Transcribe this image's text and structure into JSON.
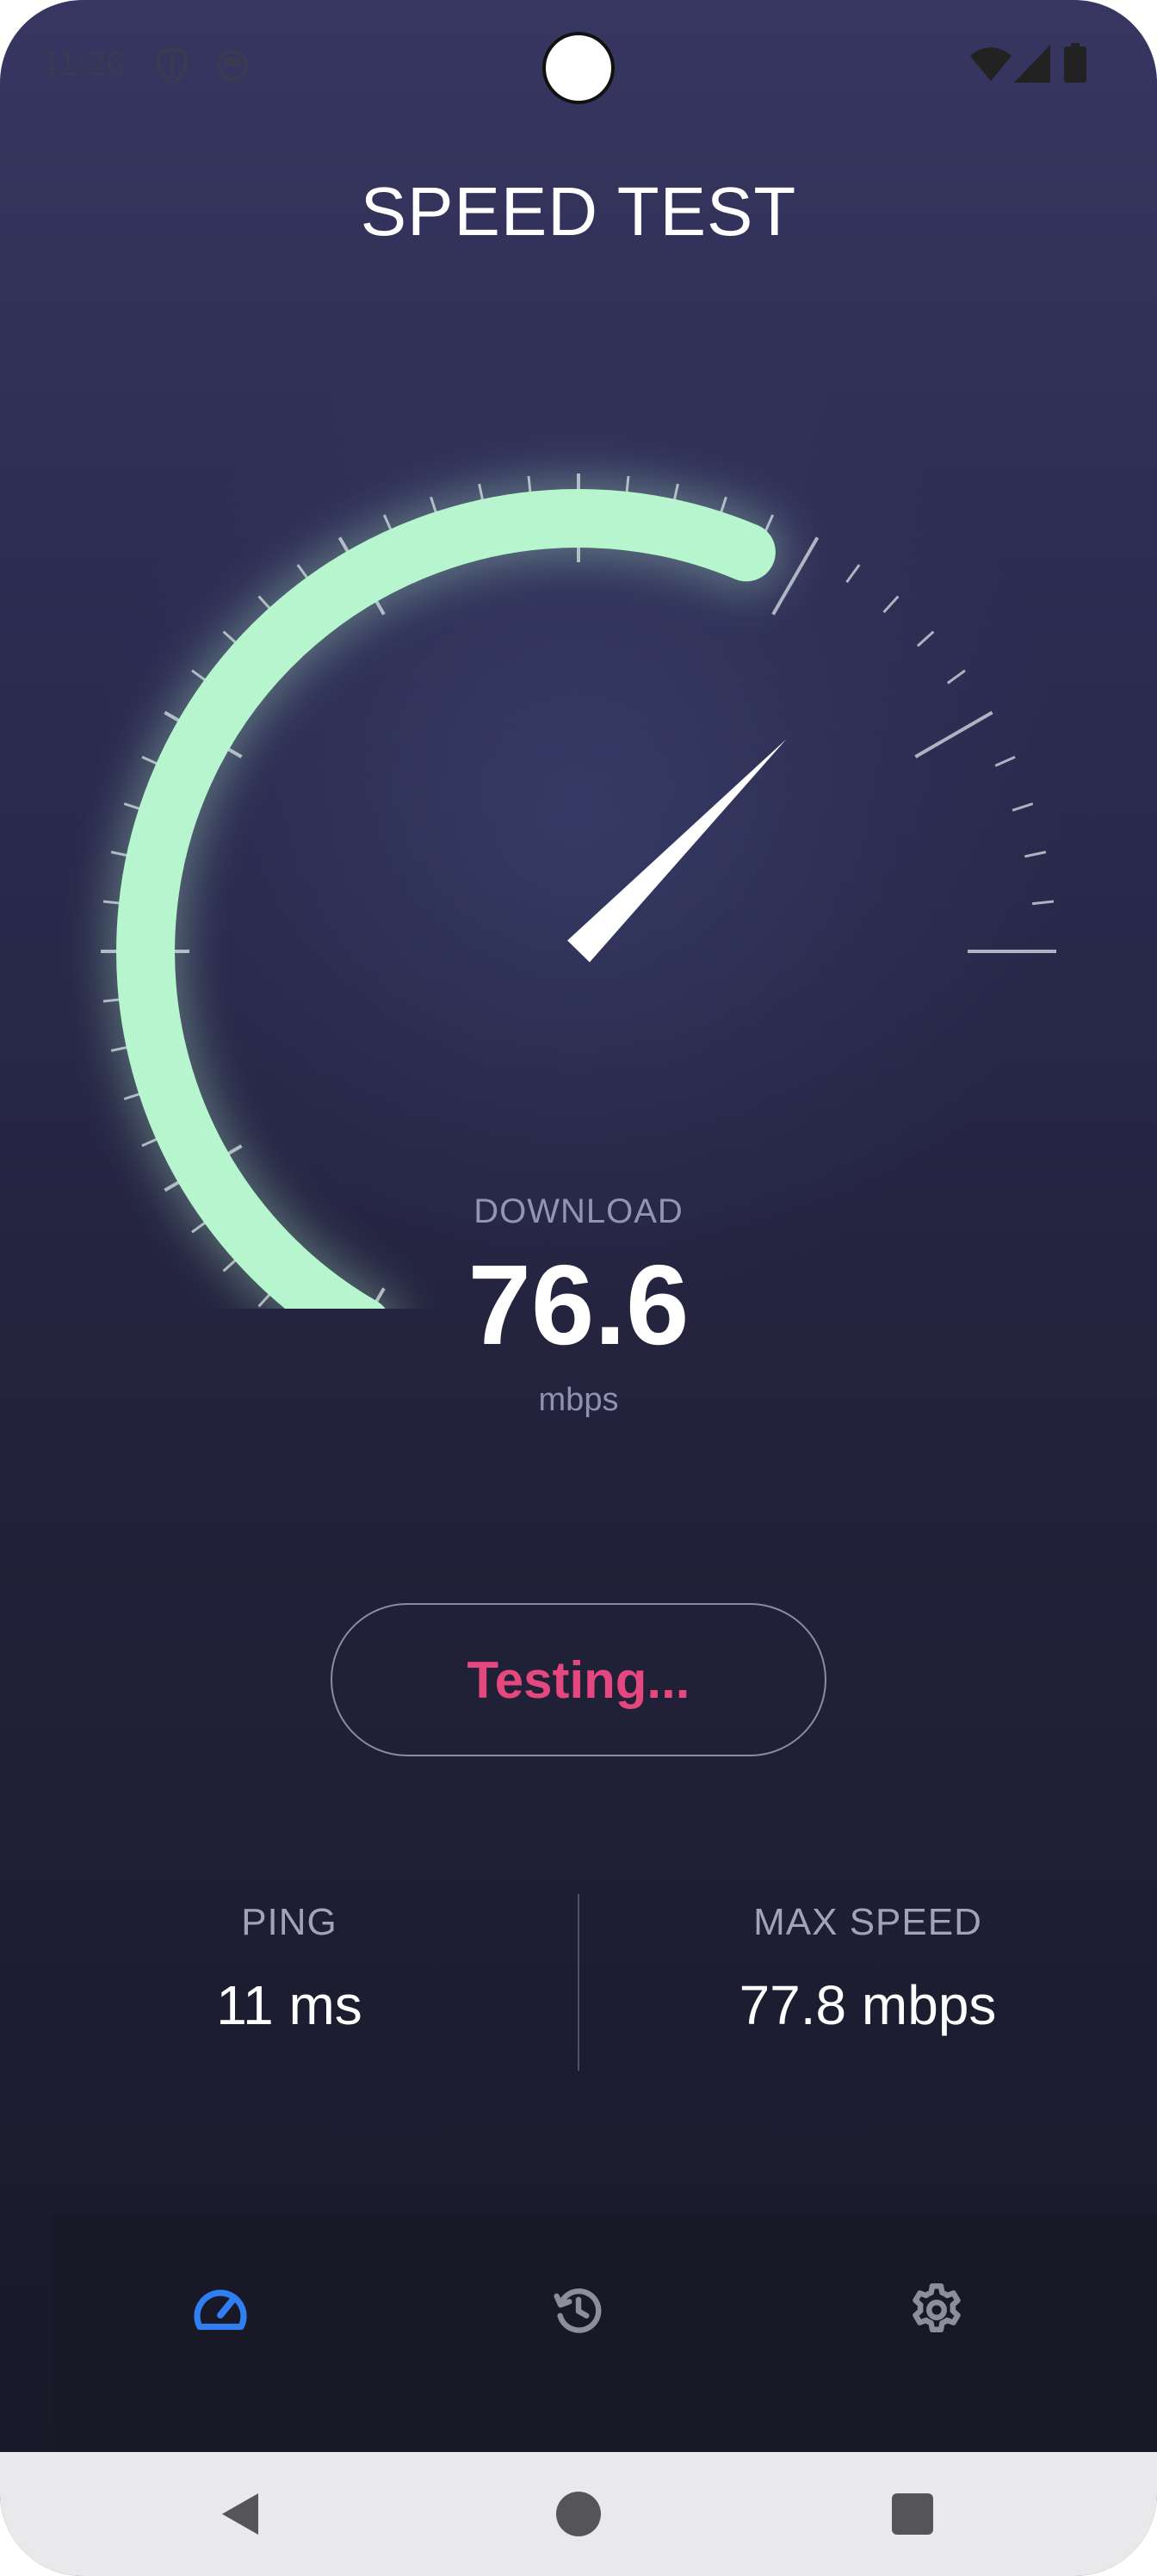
{
  "status_bar": {
    "time": "11:26",
    "icons": [
      "shield-icon",
      "app-notification-icon",
      "wifi-icon",
      "cellular-signal-icon",
      "battery-icon"
    ]
  },
  "title": "SPEED TEST",
  "gauge": {
    "progress_fraction": 0.72,
    "needle_fraction": 0.81,
    "accent_color": "#b7f5cf",
    "tick_color": "#c8c9d6"
  },
  "readout": {
    "label": "DOWNLOAD",
    "value": "76.6",
    "unit": "mbps"
  },
  "action_button": {
    "label": "Testing...",
    "color": "#e5487e"
  },
  "stats": {
    "ping": {
      "label": "PING",
      "value": "11 ms"
    },
    "max_speed": {
      "label": "MAX SPEED",
      "value": "77.8 mbps"
    }
  },
  "bottom_nav": {
    "items": [
      {
        "icon": "speedometer-icon",
        "active": true
      },
      {
        "icon": "history-icon",
        "active": false
      },
      {
        "icon": "settings-gear-icon",
        "active": false
      }
    ],
    "active_color": "#2f7ff2",
    "inactive_color": "#8d8e9b"
  },
  "system_nav": {
    "buttons": [
      "back-icon",
      "home-icon",
      "recents-icon"
    ]
  }
}
